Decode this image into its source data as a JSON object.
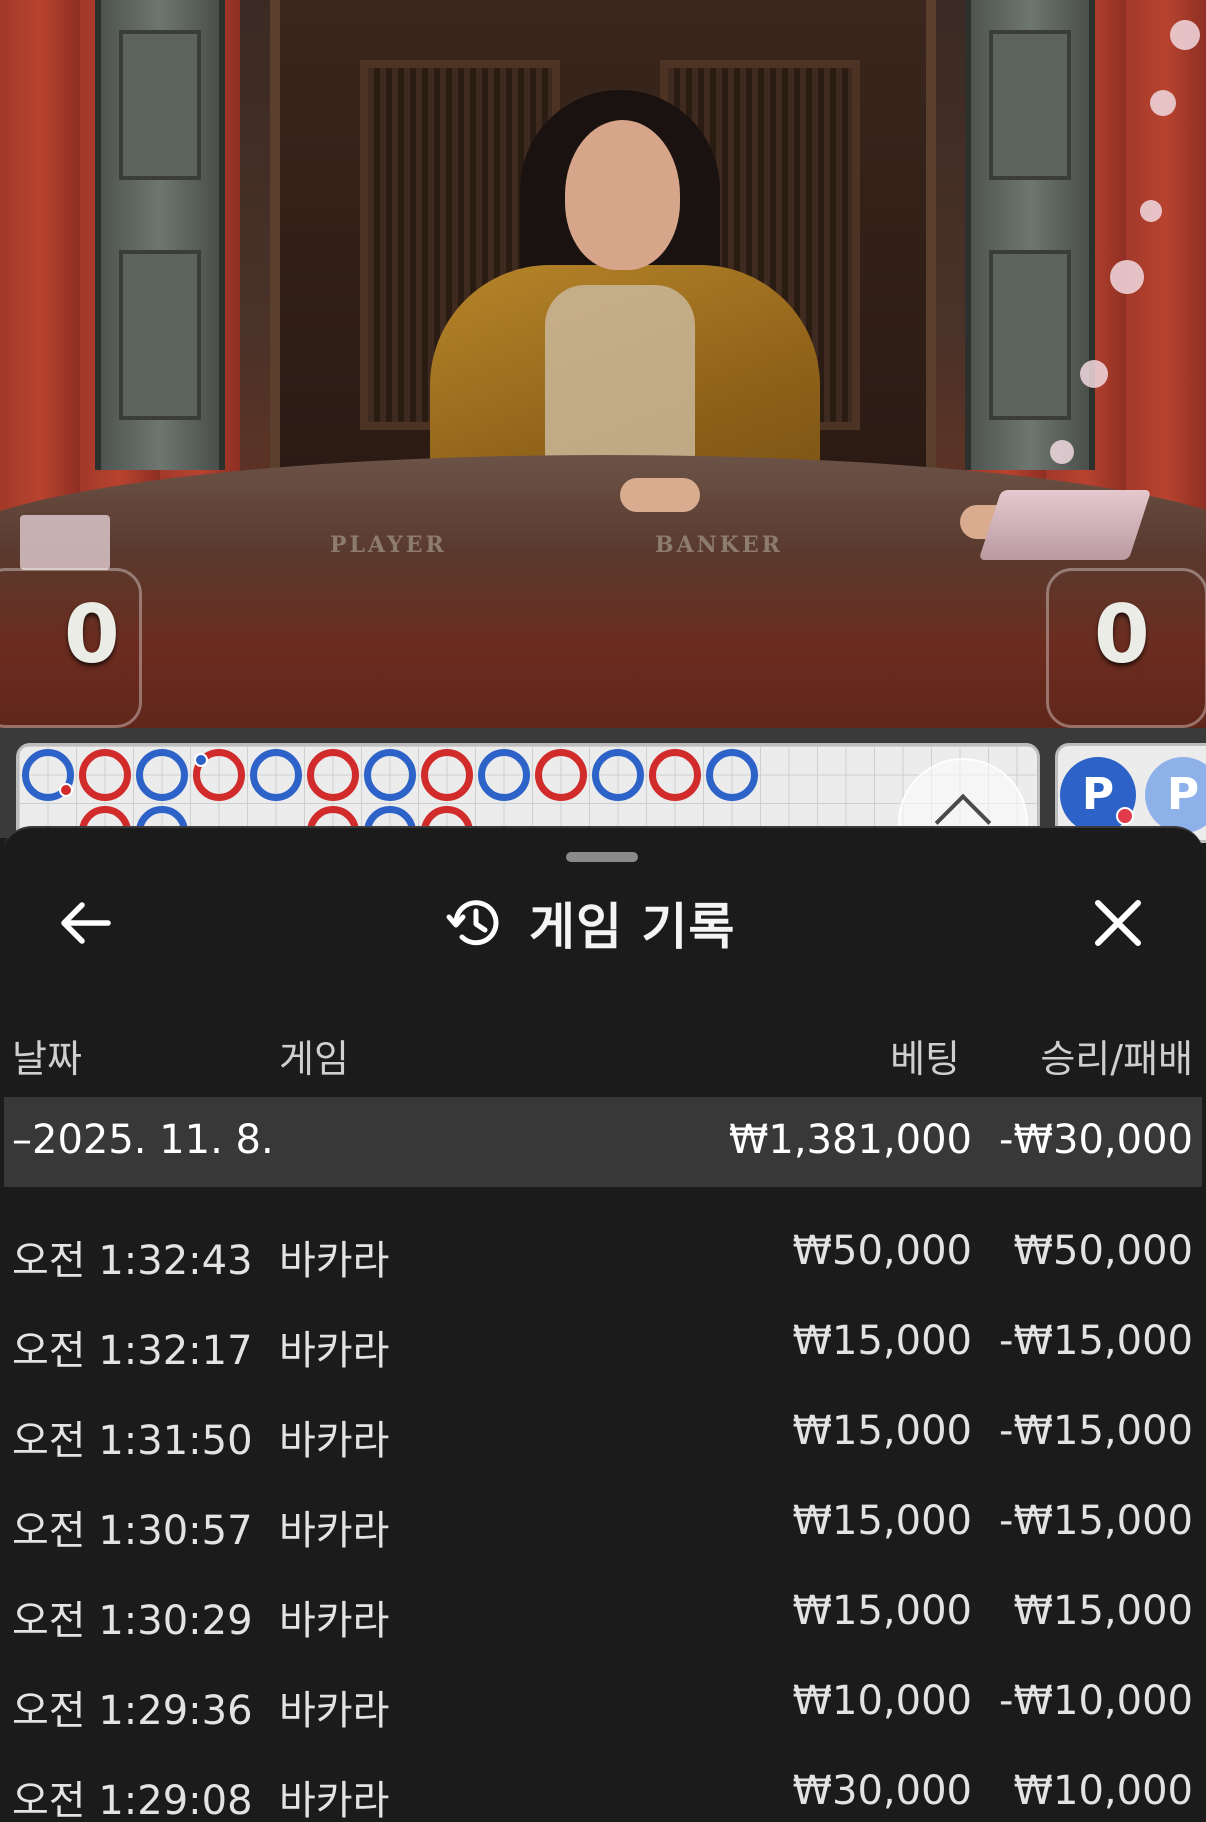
{
  "video": {
    "table_labels": {
      "player": "PLAYER",
      "banker": "BANKER"
    },
    "scores": {
      "player": "0",
      "banker": "0"
    }
  },
  "roadmap": {
    "row1": [
      "B",
      "P",
      "B",
      "P",
      "B",
      "P",
      "B",
      "P",
      "B",
      "P",
      "B",
      "P",
      "B"
    ],
    "row1_first_dot": "red",
    "row1_fourth_dot": "blue",
    "row2": [
      "P",
      "B",
      "",
      "",
      "P",
      "B",
      "P"
    ],
    "prediction_letter": "P",
    "colors": {
      "banker_blue": "#2d63c8",
      "player_red": "#d22b2b"
    },
    "icons": {
      "expand": "chevron-up-icon"
    }
  },
  "sheet": {
    "title": "게임 기록",
    "icons": {
      "back": "arrow-left-icon",
      "history": "history-icon",
      "close": "close-icon"
    },
    "columns": {
      "date": "날짜",
      "game": "게임",
      "bet": "베팅",
      "result": "승리/패배"
    },
    "group": {
      "date": "–2025. 11. 8.",
      "bet": "₩1,381,000",
      "result": "-₩30,000"
    },
    "rows": [
      {
        "time": "오전 1:32:43",
        "game": "바카라",
        "bet": "₩50,000",
        "result": "₩50,000"
      },
      {
        "time": "오전 1:32:17",
        "game": "바카라",
        "bet": "₩15,000",
        "result": "-₩15,000"
      },
      {
        "time": "오전 1:31:50",
        "game": "바카라",
        "bet": "₩15,000",
        "result": "-₩15,000"
      },
      {
        "time": "오전 1:30:57",
        "game": "바카라",
        "bet": "₩15,000",
        "result": "-₩15,000"
      },
      {
        "time": "오전 1:30:29",
        "game": "바카라",
        "bet": "₩15,000",
        "result": "₩15,000"
      },
      {
        "time": "오전 1:29:36",
        "game": "바카라",
        "bet": "₩10,000",
        "result": "-₩10,000"
      },
      {
        "time": "오전 1:29:08",
        "game": "바카라",
        "bet": "₩30,000",
        "result": "₩10,000"
      }
    ]
  }
}
